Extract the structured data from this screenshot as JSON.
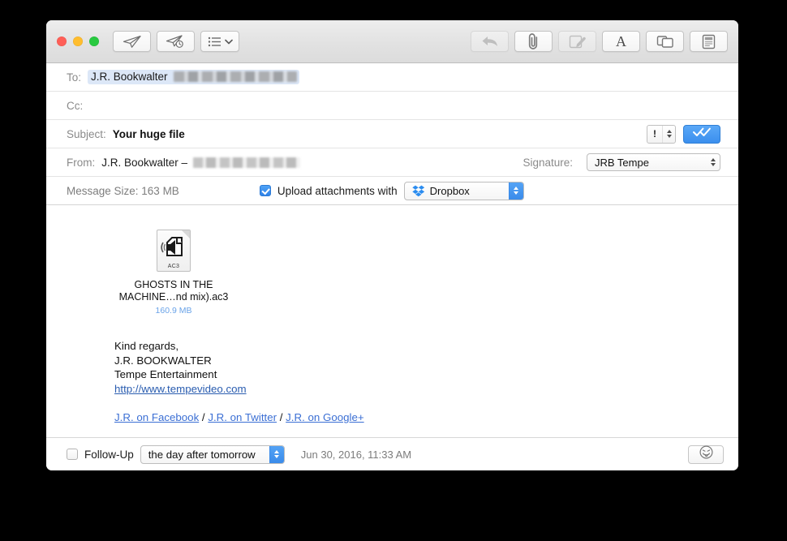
{
  "window": {
    "traffic_lights": [
      {
        "name": "close",
        "color": "#ff5f57"
      },
      {
        "name": "minimize",
        "color": "#ffbd2e"
      },
      {
        "name": "zoom",
        "color": "#28c940"
      }
    ]
  },
  "toolbar": {
    "left": [
      {
        "name": "send-button",
        "icon": "paper-plane-icon"
      },
      {
        "name": "send-later-button",
        "icon": "paper-plane-clock-icon"
      },
      {
        "name": "template-list-button",
        "icon": "list-chevron-down-icon"
      }
    ],
    "right": [
      {
        "name": "reply-button",
        "icon": "reply-arrow-icon",
        "disabled": true
      },
      {
        "name": "attach-button",
        "icon": "paperclip-icon",
        "disabled": false
      },
      {
        "name": "markup-button",
        "icon": "attachment-pen-icon",
        "disabled": true
      },
      {
        "name": "format-button",
        "icon": "letter-a-icon",
        "label": "A",
        "disabled": false
      },
      {
        "name": "photo-browser-button",
        "icon": "overlapping-windows-icon",
        "disabled": false
      },
      {
        "name": "stationery-button",
        "icon": "stationery-document-icon",
        "disabled": false
      }
    ]
  },
  "headers": {
    "to": {
      "label": "To:",
      "recipient_name": "J.R. Bookwalter",
      "recipient_email_redacted": true
    },
    "cc": {
      "label": "Cc:",
      "value": ""
    },
    "subject": {
      "label": "Subject:",
      "value": "Your huge file",
      "priority_value": "!",
      "send_check_icon": "double-check-icon"
    },
    "from": {
      "label": "From:",
      "value": "J.R. Bookwalter –",
      "email_redacted": true,
      "signature_label": "Signature:",
      "signature_value": "JRB Tempe"
    },
    "message_size": {
      "label": "Message Size: 163 MB",
      "upload_checkbox_label": "Upload attachments with",
      "upload_checked": true,
      "service_value": "Dropbox",
      "service_icon": "dropbox-logo-icon"
    }
  },
  "body": {
    "attachment": {
      "icon_extension": "AC3",
      "filename_line1": "GHOSTS IN THE",
      "filename_line2": "MACHINE…nd mix).ac3",
      "size": "160.9 MB"
    },
    "signature": {
      "line1": "Kind regards,",
      "line2": "J.R. BOOKWALTER",
      "line3": "Tempe Entertainment",
      "website": "http://www.tempevideo.com"
    },
    "social": {
      "facebook": "J.R. on Facebook",
      "sep1": " / ",
      "twitter": "J.R. on Twitter",
      "sep2": " / ",
      "googleplus": "J.R. on Google+"
    }
  },
  "footer": {
    "followup_label": "Follow-Up",
    "followup_checked": false,
    "followup_value": "the day after tomorrow",
    "timestamp": "Jun 30, 2016, 11:33 AM",
    "emoji_button_icon": "smiley-tongue-icon"
  },
  "colors": {
    "accent_blue": "#3b8fee",
    "link_blue": "#3b6fd4",
    "token_blue": "#dce7f7",
    "size_blue": "#6aa3e8"
  }
}
